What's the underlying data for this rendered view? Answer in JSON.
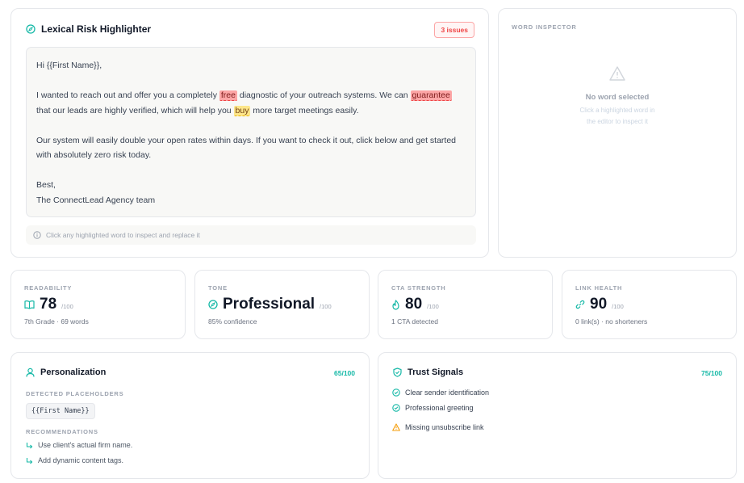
{
  "lexical": {
    "title": "Lexical Risk Highlighter",
    "issues_badge": "3 issues",
    "greeting": "Hi {{First Name}},",
    "p1_a": "I wanted to reach out and offer you a completely ",
    "p1_flag1": "free",
    "p1_b": " diagnostic of your outreach systems. We can ",
    "p1_flag2": "guarantee",
    "p1_c": " that our leads are highly verified, which will help you ",
    "p1_flag3": "buy",
    "p1_d": " more target meetings easily.",
    "p2": "Our system will easily double your open rates within days. If you want to check it out, click below and get started with absolutely zero risk today.",
    "sign1": "Best,",
    "sign2": "The ConnectLead Agency team",
    "hint": "Click any highlighted word to inspect and replace it"
  },
  "inspector": {
    "label": "WORD INSPECTOR",
    "empty_title": "No word selected",
    "empty_line1": "Click a highlighted word in",
    "empty_line2": "the editor to inspect it"
  },
  "metrics": [
    {
      "label": "READABILITY",
      "value": "78",
      "of": "/100",
      "sub": "7th Grade · 69 words",
      "icon": "book-icon"
    },
    {
      "label": "TONE",
      "value": "Professional",
      "of": "/100",
      "sub": "85% confidence",
      "icon": "compass-icon"
    },
    {
      "label": "CTA STRENGTH",
      "value": "80",
      "of": "/100",
      "sub": "1 CTA detected",
      "icon": "flame-icon"
    },
    {
      "label": "LINK HEALTH",
      "value": "90",
      "of": "/100",
      "sub": "0 link(s) · no shorteners",
      "icon": "link-icon"
    }
  ],
  "personalization": {
    "title": "Personalization",
    "score": "65/100",
    "detected_label": "DETECTED PLACEHOLDERS",
    "placeholder": "{{First Name}}",
    "rec_label": "RECOMMENDATIONS",
    "recommendations": [
      "Use client's actual firm name.",
      "Add dynamic content tags."
    ]
  },
  "trust": {
    "title": "Trust Signals",
    "score": "75/100",
    "signals": [
      "Clear sender identification",
      "Professional greeting",
      "Missing unsubscribe link"
    ]
  },
  "colors": {
    "accent": "#14b8a6",
    "danger": "#ef4444",
    "warning": "#f59e0b"
  }
}
